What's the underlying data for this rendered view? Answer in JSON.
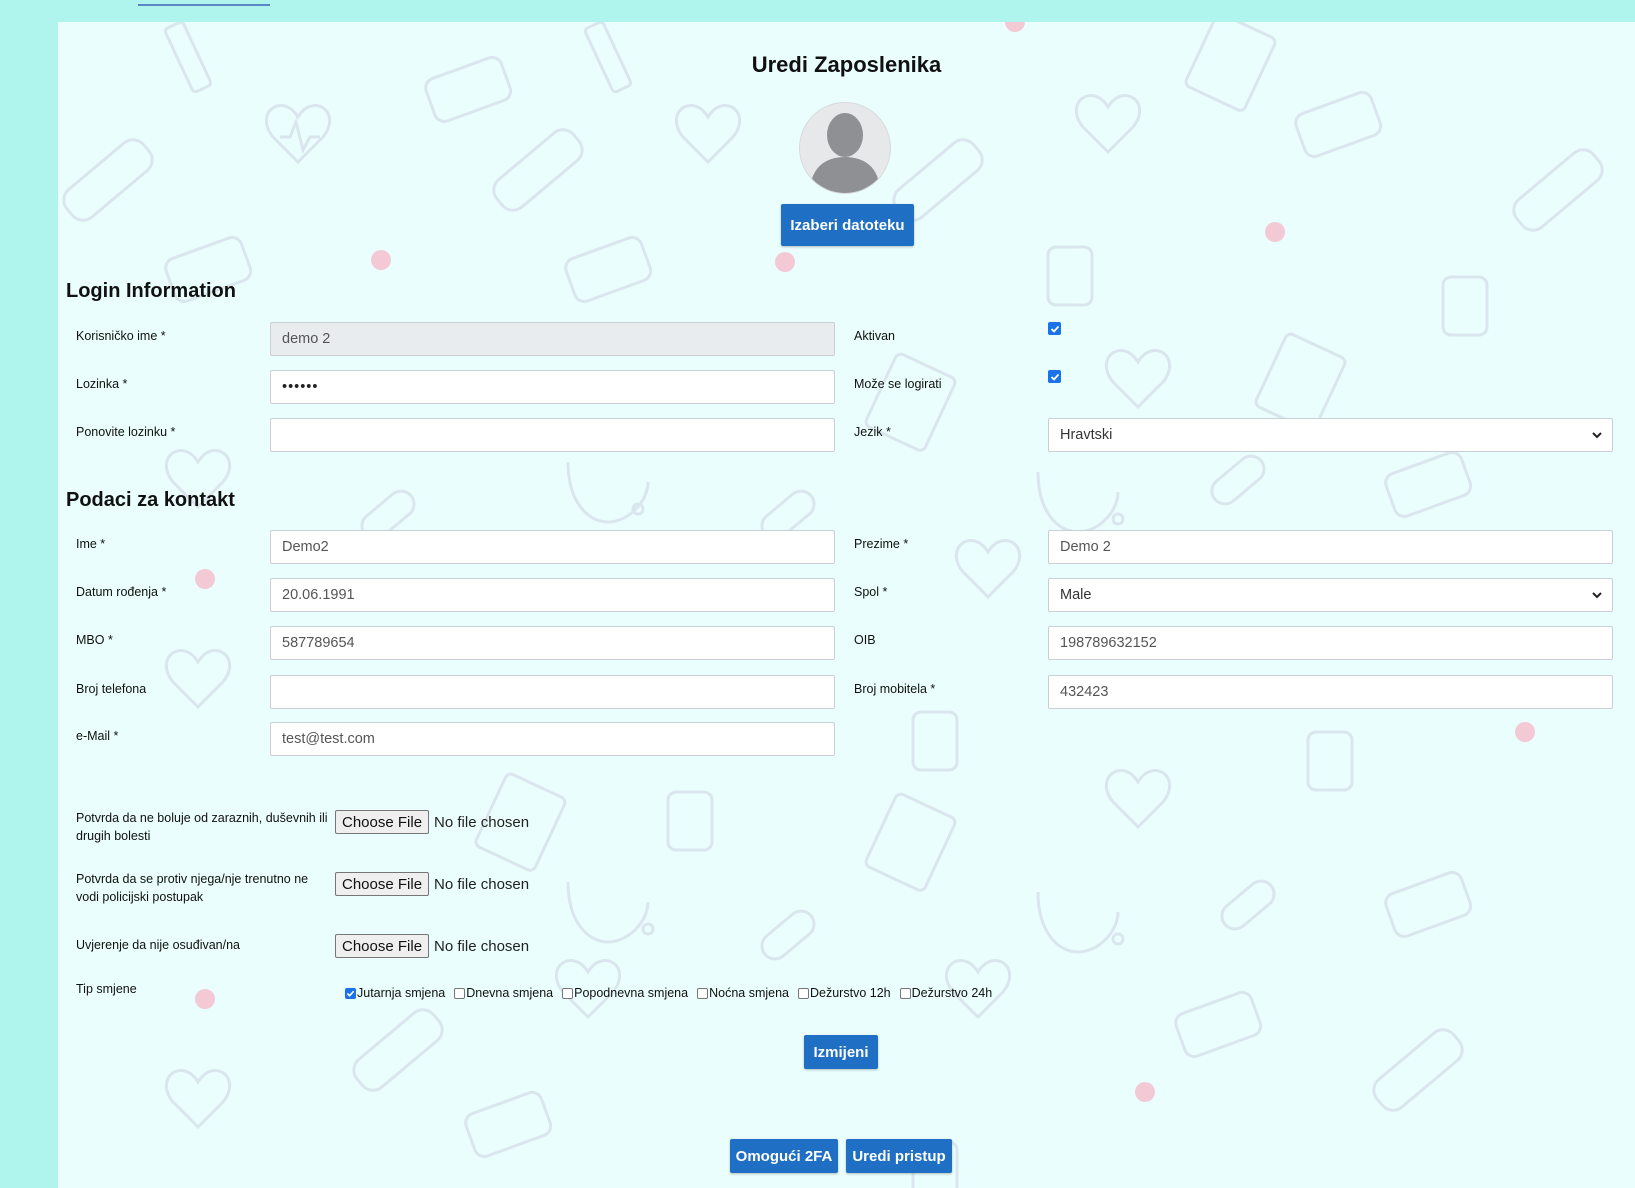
{
  "page": {
    "title": "Uredi Zaposlenika",
    "choose_file_button": "Izaberi datoteku"
  },
  "login": {
    "section_title": "Login Information",
    "username_label": "Korisničko ime *",
    "username_value": "demo 2",
    "password_label": "Lozinka *",
    "password_value": "••••••",
    "repeat_password_label": "Ponovite lozinku *",
    "repeat_password_value": "",
    "active_label": "Aktivan",
    "active_checked": true,
    "can_login_label": "Može se logirati",
    "can_login_checked": true,
    "language_label": "Jezik *",
    "language_value": "Hravtski"
  },
  "contact": {
    "section_title": "Podaci za kontakt",
    "first_name_label": "Ime *",
    "first_name_value": "Demo2",
    "last_name_label": "Prezime *",
    "last_name_value": "Demo 2",
    "birth_label": "Datum rođenja *",
    "birth_value": "20.06.1991",
    "gender_label": "Spol *",
    "gender_value": "Male",
    "mbo_label": "MBO *",
    "mbo_value": "587789654",
    "oib_label": "OIB",
    "oib_value": "198789632152",
    "phone_label": "Broj telefona",
    "phone_value": "",
    "mobile_label": "Broj mobitela *",
    "mobile_value": "432423",
    "email_label": "e-Mail *",
    "email_value": "test@test.com"
  },
  "documents": {
    "choose_file": "Choose File",
    "no_file": "No file chosen",
    "items": [
      {
        "label_line1": "Potvrda da ne boluje od zaraznih, duševnih ili",
        "label_line2": "drugih bolesti"
      },
      {
        "label_line1": "Potvrda da se protiv njega/nje trenutno ne",
        "label_line2": "vodi policijski postupak"
      },
      {
        "label_line1": "Uvjerenje da nije osuđivan/na",
        "label_line2": ""
      }
    ]
  },
  "shifts": {
    "label": "Tip smjene",
    "items": [
      {
        "label": "Jutarnja smjena",
        "checked": true
      },
      {
        "label": "Dnevna smjena",
        "checked": false
      },
      {
        "label": "Popodnevna smjena",
        "checked": false
      },
      {
        "label": "Noćna smjena",
        "checked": false
      },
      {
        "label": "Dežurstvo 12h",
        "checked": false
      },
      {
        "label": "Dežurstvo 24h",
        "checked": false
      }
    ]
  },
  "actions": {
    "submit": "Izmijeni",
    "enable_2fa": "Omogući 2FA",
    "edit_access": "Uredi pristup"
  },
  "colors": {
    "outer_background": "#aff5ee",
    "panel_background": "#eafefd",
    "primary_button": "#1f6fc4",
    "checkbox": "#1a73e8"
  }
}
